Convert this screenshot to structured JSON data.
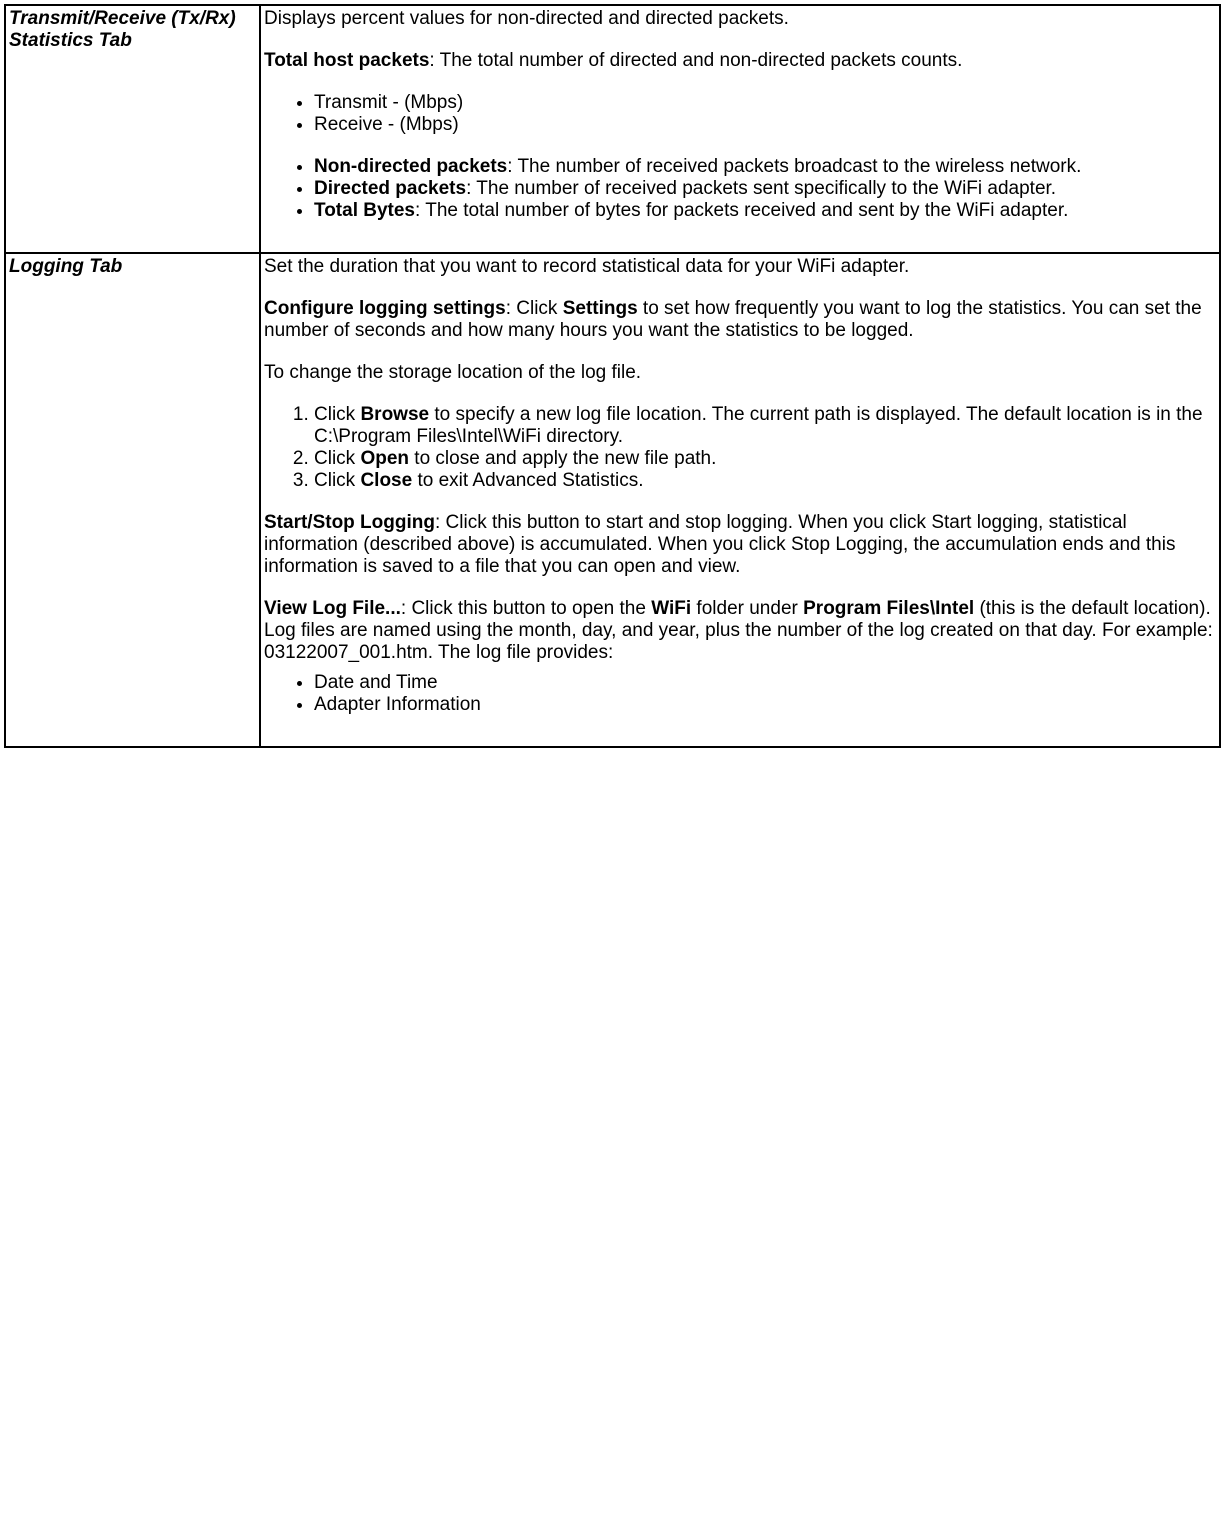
{
  "rows": [
    {
      "label": "Transmit/Receive (Tx/Rx) Statistics Tab",
      "intro": "Displays percent values for non-directed and directed packets.",
      "total_host_label": "Total host packets",
      "total_host_text": ": The total number of directed and non-directed packets counts.",
      "rate_list": [
        "Transmit - (Mbps)",
        "Receive - (Mbps)"
      ],
      "defs": [
        {
          "term": "Non-directed packets",
          "text": ": The number of received packets broadcast to the wireless network."
        },
        {
          "term": "Directed packets",
          "text": ": The number of received packets sent specifically to the WiFi adapter."
        },
        {
          "term": "Total Bytes",
          "text": ": The total number of bytes for packets received and sent by the WiFi adapter."
        }
      ]
    },
    {
      "label": "Logging Tab",
      "intro": "Set the duration that you want to record statistical data for your WiFi adapter.",
      "configure_label": "Configure logging settings",
      "configure_pre": ": Click ",
      "configure_settings": "Settings",
      "configure_post": " to set how frequently you want to log the statistics. You can set the number of seconds and how many hours you want the statistics to be logged.",
      "change_loc": "To change the storage location of the log file.",
      "steps": [
        {
          "pre": "Click ",
          "b": "Browse",
          "post": " to specify a new log file location. The current path is displayed. The default location is in the C:\\Program Files\\Intel\\WiFi directory."
        },
        {
          "pre": "Click ",
          "b": "Open",
          "post": " to close and apply the new file path."
        },
        {
          "pre": "Click ",
          "b": "Close",
          "post": " to exit Advanced Statistics."
        }
      ],
      "startstop_label": "Start/Stop Logging",
      "startstop_text": ": Click this button to start and stop logging. When you click Start logging, statistical information (described above) is accumulated. When you click Stop Logging, the accumulation ends and this information is saved to a file that you can open and view.",
      "viewlog_label": "View Log File...",
      "viewlog_pre": ": Click this button to open the ",
      "viewlog_b1": "WiFi",
      "viewlog_mid": " folder under ",
      "viewlog_b2": "Program Files\\Intel",
      "viewlog_post": " (this is the default location). Log files are named using the month, day, and year, plus the number of the log created on that day. For example: 03122007_001.htm. The log file provides:",
      "provides": [
        "Date and Time",
        "Adapter Information"
      ]
    }
  ]
}
